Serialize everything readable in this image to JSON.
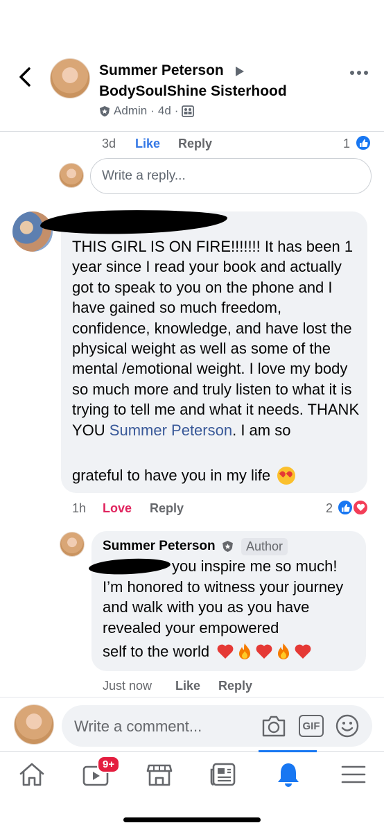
{
  "header": {
    "author": "Summer Peterson",
    "group": "BodySoulShine Sisterhood",
    "role": "Admin",
    "sep1": "·",
    "age": "4d",
    "sep2": "·"
  },
  "first_comment_actions": {
    "time": "3d",
    "like": "Like",
    "reply": "Reply",
    "reaction_count": "1"
  },
  "reply_box": {
    "placeholder": "Write a reply..."
  },
  "main_comment": {
    "text_before": "THIS GIRL IS ON FIRE!!!!!!!  It has been 1 year since I read your book and actually got to speak to you on the phone and I have gained so much freedom, confidence, knowledge, and have lost the physical weight as well as some of the mental /emotional weight.  I love my body so much more and truly listen to what it is trying to tell me and what it needs.  THANK YOU ",
    "mention": "Summer Peterson",
    "text_after": ".  I am so",
    "last_line": "grateful to have you in my life",
    "time": "1h",
    "reaction_label": "Love",
    "reply": "Reply",
    "reaction_count": "2"
  },
  "author_reply": {
    "name": "Summer Peterson",
    "badge": "Author",
    "text": "you inspire me so much! I’m honored to witness your journey and walk with you as you have revealed your empowered",
    "last_line": "self to the world",
    "time": "Just now",
    "like": "Like",
    "reply": "Reply"
  },
  "composer": {
    "placeholder": "Write a comment...",
    "gif": "GIF"
  },
  "nav": {
    "badge": "9+"
  },
  "colors": {
    "accent": "#1877f2",
    "love": "#e0245e",
    "mention": "#385898",
    "bubble": "#f0f2f5"
  },
  "icons": [
    "back-chevron-icon",
    "more-icon",
    "shield-icon",
    "group-icon",
    "like-reaction-icon",
    "love-reaction-icon",
    "heart-emoji-icon",
    "fire-emoji-icon",
    "heart-eyes-emoji-icon",
    "camera-icon",
    "gif-icon",
    "smile-icon",
    "home-icon",
    "watch-icon",
    "marketplace-icon",
    "news-icon",
    "bell-icon",
    "menu-icon"
  ]
}
